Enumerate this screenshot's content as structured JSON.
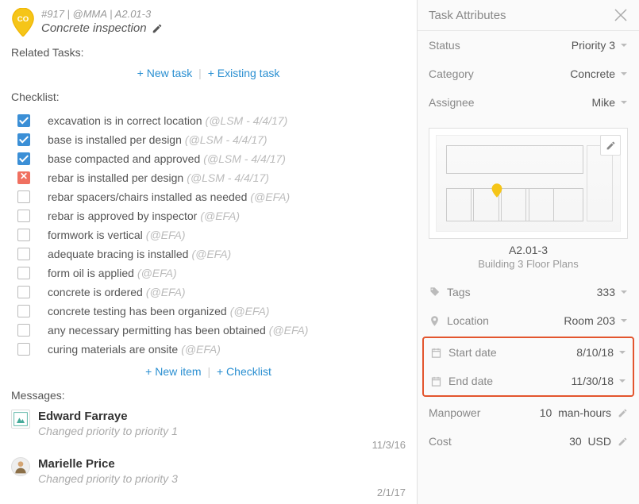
{
  "header": {
    "meta": "#917 | @MMA | A2.01-3",
    "title": "Concrete inspection"
  },
  "related": {
    "label": "Related Tasks:",
    "new_task": "+ New task",
    "existing_task": "+ Existing task"
  },
  "checklist": {
    "label": "Checklist:",
    "items": [
      {
        "text": "excavation is in correct location",
        "meta": "(@LSM - 4/4/17)",
        "state": "checked"
      },
      {
        "text": "base is installed per design",
        "meta": "(@LSM - 4/4/17)",
        "state": "checked"
      },
      {
        "text": "base compacted and approved",
        "meta": "(@LSM - 4/4/17)",
        "state": "checked"
      },
      {
        "text": "rebar is installed per design",
        "meta": "(@LSM - 4/4/17)",
        "state": "failed"
      },
      {
        "text": "rebar spacers/chairs installed as needed",
        "meta": "(@EFA)",
        "state": "open"
      },
      {
        "text": "rebar is approved by inspector",
        "meta": "(@EFA)",
        "state": "open"
      },
      {
        "text": "formwork is vertical",
        "meta": "(@EFA)",
        "state": "open"
      },
      {
        "text": "adequate bracing is installed",
        "meta": "(@EFA)",
        "state": "open"
      },
      {
        "text": "form oil is applied",
        "meta": "(@EFA)",
        "state": "open"
      },
      {
        "text": "concrete is ordered",
        "meta": "(@EFA)",
        "state": "open"
      },
      {
        "text": "concrete testing has been organized",
        "meta": "(@EFA)",
        "state": "open"
      },
      {
        "text": "any necessary permitting has been obtained",
        "meta": "(@EFA)",
        "state": "open"
      },
      {
        "text": "curing materials are onsite",
        "meta": "(@EFA)",
        "state": "open"
      }
    ],
    "new_item": "+ New item",
    "add_checklist": "+ Checklist"
  },
  "messages": {
    "label": "Messages:",
    "items": [
      {
        "name": "Edward Farraye",
        "action": "Changed priority to priority 1",
        "date": "11/3/16"
      },
      {
        "name": "Marielle Price",
        "action": "Changed priority to priority 3",
        "date": "2/1/17"
      }
    ]
  },
  "attributes": {
    "title": "Task Attributes",
    "status_label": "Status",
    "status_value": "Priority 3",
    "category_label": "Category",
    "category_value": "Concrete",
    "assignee_label": "Assignee",
    "assignee_value": "Mike",
    "thumb_caption": "A2.01-3",
    "thumb_subcaption": "Building 3 Floor Plans",
    "tags_label": "Tags",
    "tags_value": "333",
    "location_label": "Location",
    "location_value": "Room 203",
    "start_label": "Start date",
    "start_value": "8/10/18",
    "end_label": "End date",
    "end_value": "11/30/18",
    "manpower_label": "Manpower",
    "manpower_value": "10",
    "manpower_unit": "man-hours",
    "cost_label": "Cost",
    "cost_value": "30",
    "cost_unit": "USD"
  }
}
